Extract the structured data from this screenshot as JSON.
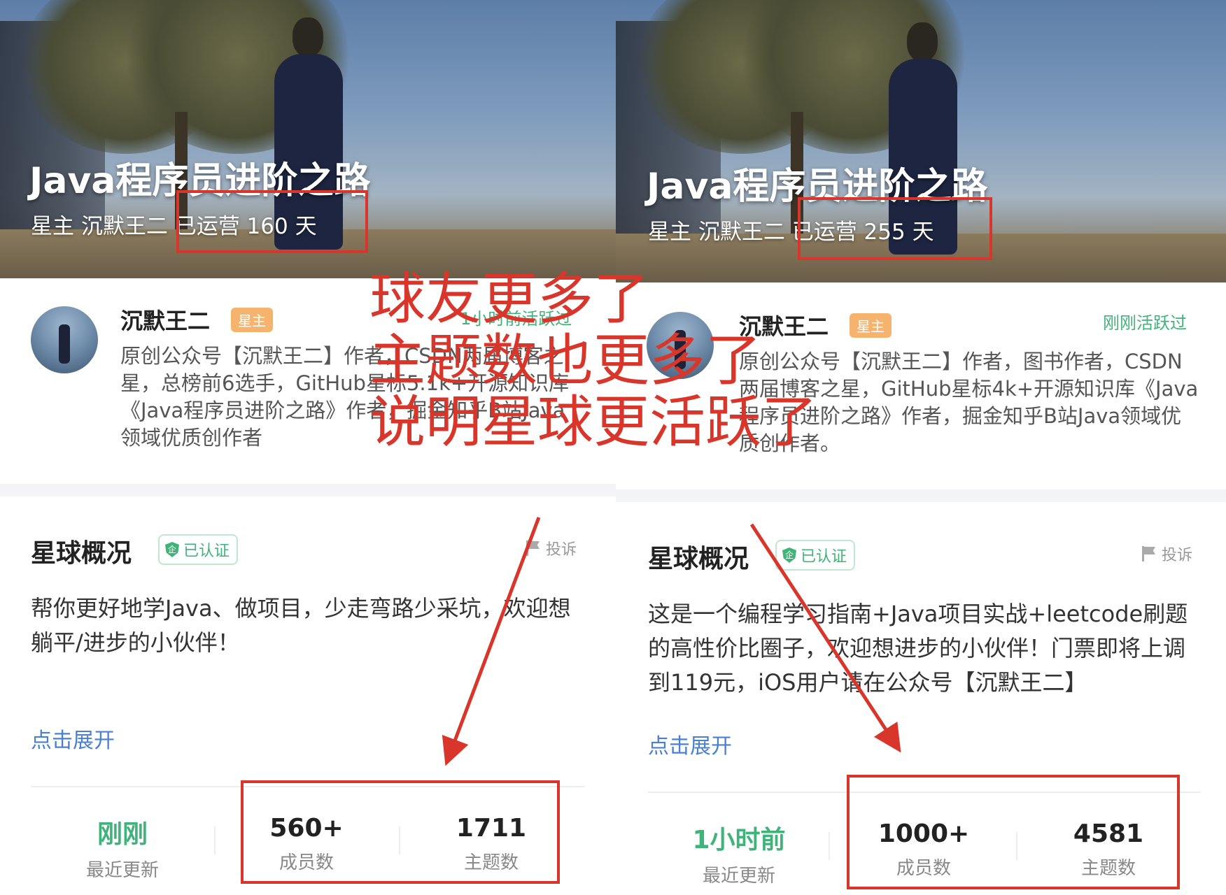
{
  "left": {
    "hero": {
      "title": "Java程序员进阶之路",
      "meta": "星主 沉默王二 已运营 160 天"
    },
    "owner": {
      "name": "沉默王二",
      "badge": "星主",
      "active": "1小时前活跃过",
      "bio": "原创公众号【沉默王二】作者，CSDN两届博客之星，总榜前6选手，GitHub星标5.1k+开源知识库《Java程序员进阶之路》作者，掘金知乎B站Java领域优质创作者"
    },
    "overview": {
      "title": "星球概况",
      "verified": "已认证",
      "report": "投诉",
      "description": "帮你更好地学Java、做项目，少走弯路少采坑，欢迎想躺平/进步的小伙伴！",
      "expand": "点击展开"
    },
    "stats": [
      {
        "value": "刚刚",
        "label": "最近更新"
      },
      {
        "value": "560+",
        "label": "成员数"
      },
      {
        "value": "1711",
        "label": "主题数"
      }
    ]
  },
  "right": {
    "hero": {
      "title": "Java程序员进阶之路",
      "meta": "星主 沉默王二 已运营 255 天"
    },
    "owner": {
      "name": "沉默王二",
      "badge": "星主",
      "active": "刚刚活跃过",
      "bio": "原创公众号【沉默王二】作者，图书作者，CSDN两届博客之星，GitHub星标4k+开源知识库《Java程序员进阶之路》作者，掘金知乎B站Java领域优质创作者。"
    },
    "overview": {
      "title": "星球概况",
      "verified": "已认证",
      "report": "投诉",
      "description": "这是一个编程学习指南+Java项目实战+leetcode刷题的高性价比圈子，欢迎想进步的小伙伴！门票即将上调到119元，iOS用户请在公众号【沉默王二】",
      "expand": "点击展开"
    },
    "stats": [
      {
        "value": "1小时前",
        "label": "最近更新"
      },
      {
        "value": "1000+",
        "label": "成员数"
      },
      {
        "value": "4581",
        "label": "主题数"
      }
    ]
  },
  "annotation": {
    "lines": [
      "球友更多了",
      "主题数也更多了",
      "说明星球更活跃了"
    ],
    "color": "#d9362b"
  },
  "colors": {
    "green": "#3fb37a",
    "badge": "#f5b36e",
    "link": "#4a7fd1"
  }
}
